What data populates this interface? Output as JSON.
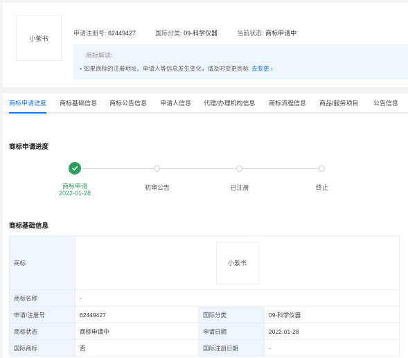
{
  "header": {
    "logo_text": "小紫书",
    "reg_no_label": "申请注册号: ",
    "reg_no": "62449427",
    "intl_class_label": "国际分类: ",
    "intl_class": "09-科学仪器",
    "status_label": "当前状态: ",
    "status": "商标申请中",
    "explain_title": "商标解读:",
    "explain_text": "如果商标的注册地址、申请人等信息发生变化，请及时变更商标",
    "explain_link": "去变更 ›"
  },
  "tabs": [
    {
      "label": "商标申请进度",
      "active": true
    },
    {
      "label": "商标基础信息"
    },
    {
      "label": "商标公告信息"
    },
    {
      "label": "申请人信息"
    },
    {
      "label": "代理/办理机构信息"
    },
    {
      "label": "商标流程信息"
    },
    {
      "label": "商品/服务项目"
    },
    {
      "label": "公告信息"
    }
  ],
  "progress": {
    "title": "商标申请进度",
    "steps": [
      {
        "label": "商标申请",
        "date": "2022-01-28",
        "done": true
      },
      {
        "label": "初审公告"
      },
      {
        "label": "已注册"
      },
      {
        "label": "终止"
      }
    ]
  },
  "basic": {
    "title": "商标基础信息",
    "mark_label": "商标",
    "mark_text": "小紫书",
    "name_label": "商标名称",
    "name_value": "-",
    "rows": [
      {
        "k1": "申请/注册号",
        "v1": "62449427",
        "k2": "国际分类",
        "v2": "09-科学仪器"
      },
      {
        "k1": "商标状态",
        "v1": "商标申请中",
        "k2": "申请日期",
        "v2": "2022-01-28"
      },
      {
        "k1": "国际商标",
        "v1": "否",
        "k2": "国际注册日期",
        "v2": "-"
      }
    ]
  },
  "colors": {
    "accent": "#1677ff",
    "done": "#2e9e5b",
    "key_bg": "#eef5fc"
  }
}
